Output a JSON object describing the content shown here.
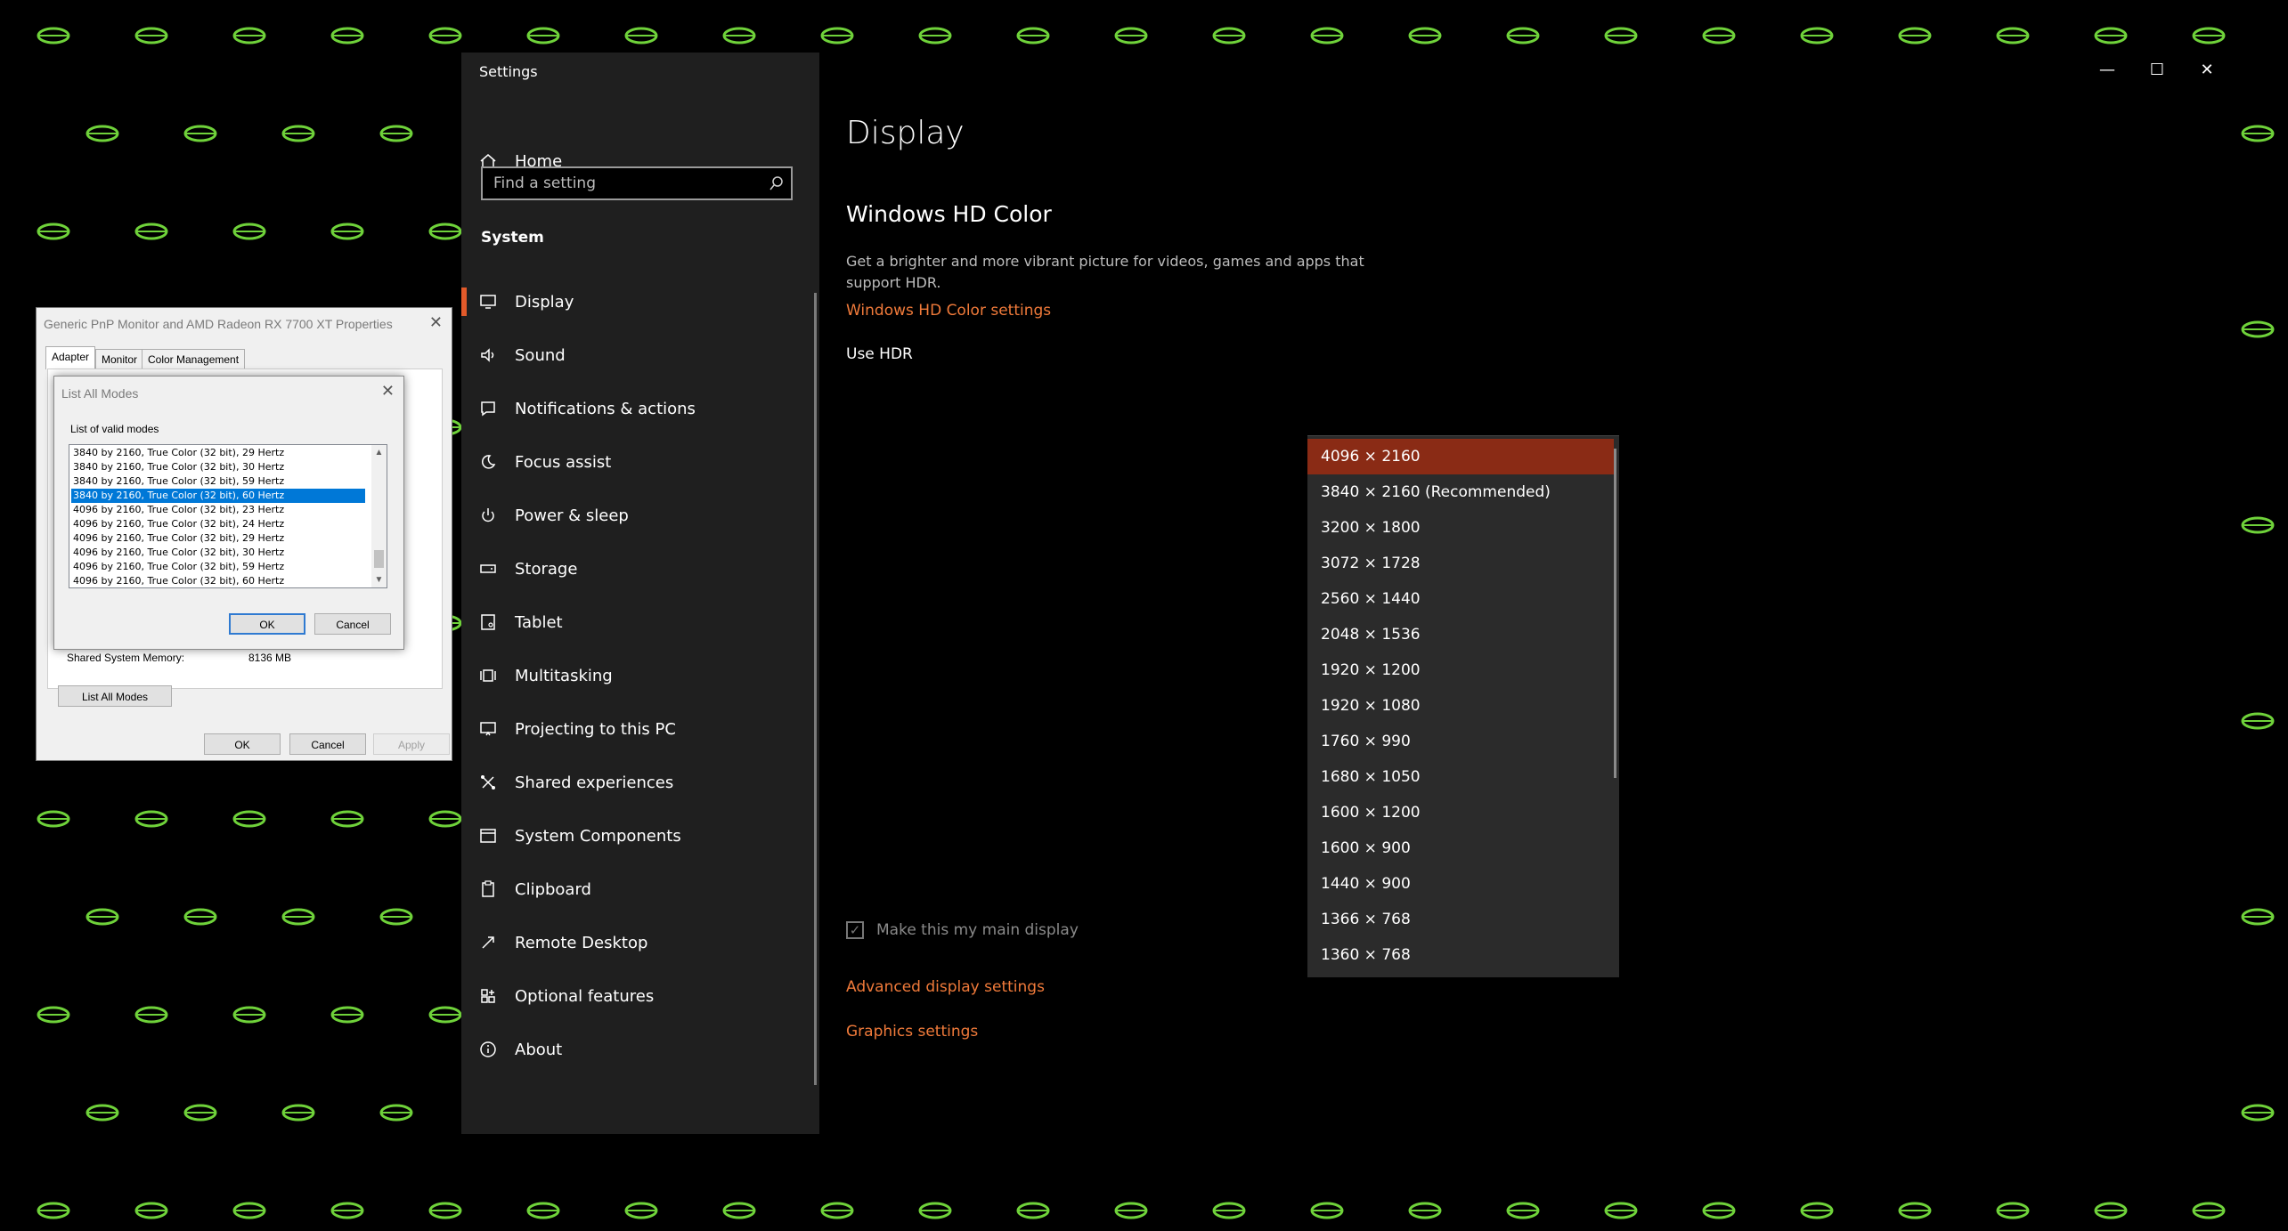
{
  "settings": {
    "window_title": "Settings",
    "controls": {
      "minimize": "—",
      "maximize": "☐",
      "close": "✕"
    },
    "sidebar": {
      "home": "Home",
      "search_placeholder": "Find a setting",
      "section": "System",
      "items": [
        {
          "id": "display",
          "label": "Display",
          "icon": "monitor-icon",
          "active": true
        },
        {
          "id": "sound",
          "label": "Sound",
          "icon": "speaker-icon"
        },
        {
          "id": "notifications",
          "label": "Notifications & actions",
          "icon": "message-icon"
        },
        {
          "id": "focus",
          "label": "Focus assist",
          "icon": "moon-icon"
        },
        {
          "id": "power",
          "label": "Power & sleep",
          "icon": "power-icon"
        },
        {
          "id": "storage",
          "label": "Storage",
          "icon": "drive-icon"
        },
        {
          "id": "tablet",
          "label": "Tablet",
          "icon": "tablet-icon"
        },
        {
          "id": "multitasking",
          "label": "Multitasking",
          "icon": "multitasking-icon"
        },
        {
          "id": "projecting",
          "label": "Projecting to this PC",
          "icon": "projector-icon"
        },
        {
          "id": "shared",
          "label": "Shared experiences",
          "icon": "share-icon"
        },
        {
          "id": "components",
          "label": "System Components",
          "icon": "window-icon"
        },
        {
          "id": "clipboard",
          "label": "Clipboard",
          "icon": "clipboard-icon"
        },
        {
          "id": "remote",
          "label": "Remote Desktop",
          "icon": "remote-icon"
        },
        {
          "id": "optional",
          "label": "Optional features",
          "icon": "grid-plus-icon"
        },
        {
          "id": "about",
          "label": "About",
          "icon": "info-icon"
        }
      ]
    },
    "content": {
      "page_title": "Display",
      "hdr_heading": "Windows HD Color",
      "hdr_description": "Get a brighter and more vibrant picture for videos, games and apps that support HDR.",
      "hdr_link": "Windows HD Color settings",
      "use_hdr_label": "Use HDR",
      "main_display_label": "Make this my main display",
      "advanced_link": "Advanced display settings",
      "graphics_link": "Graphics settings",
      "resolution_options": [
        "4096 × 2160",
        "3840 × 2160 (Recommended)",
        "3200 × 1800",
        "3072 × 1728",
        "2560 × 1440",
        "2048 × 1536",
        "1920 × 1200",
        "1920 × 1080",
        "1760 × 990",
        "1680 × 1050",
        "1600 × 1200",
        "1600 × 900",
        "1440 × 900",
        "1366 × 768",
        "1360 × 768"
      ],
      "resolution_selected_index": 0
    },
    "accent_color": "#e25a2a",
    "link_color": "#f07a3a"
  },
  "adapter_dialog": {
    "title": "Generic PnP Monitor and AMD Radeon RX 7700 XT Properties",
    "tabs": [
      "Adapter",
      "Monitor",
      "Color Management"
    ],
    "active_tab": "Adapter",
    "shared_memory_label": "Shared System Memory:",
    "shared_memory_value": "8136 MB",
    "list_all_modes_button": "List All Modes",
    "ok": "OK",
    "cancel": "Cancel",
    "apply": "Apply"
  },
  "modes_dialog": {
    "title": "List All Modes",
    "list_label": "List of valid modes",
    "modes": [
      "3840 by 2160, True Color (32 bit), 29 Hertz",
      "3840 by 2160, True Color (32 bit), 30 Hertz",
      "3840 by 2160, True Color (32 bit), 59 Hertz",
      "3840 by 2160, True Color (32 bit), 60 Hertz",
      "4096 by 2160, True Color (32 bit), 23 Hertz",
      "4096 by 2160, True Color (32 bit), 24 Hertz",
      "4096 by 2160, True Color (32 bit), 29 Hertz",
      "4096 by 2160, True Color (32 bit), 30 Hertz",
      "4096 by 2160, True Color (32 bit), 59 Hertz",
      "4096 by 2160, True Color (32 bit), 60 Hertz"
    ],
    "selected_index": 3,
    "ok": "OK",
    "cancel": "Cancel"
  }
}
